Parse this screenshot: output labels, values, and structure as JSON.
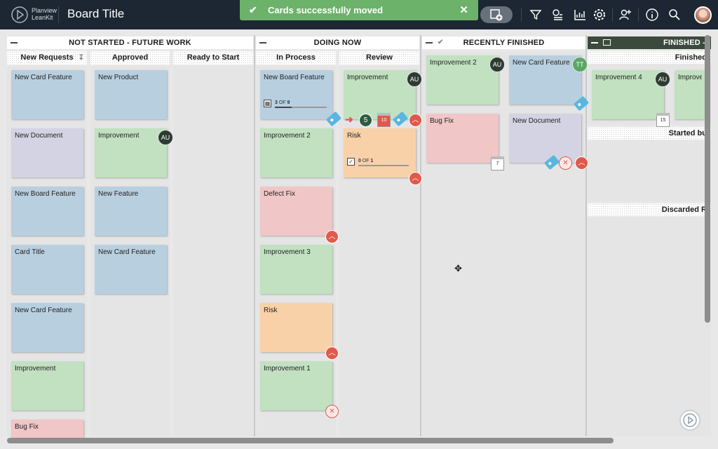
{
  "header": {
    "brand_line1": "Planview",
    "brand_line2": "LeanKit",
    "board_title": "Board Title",
    "toast_message": "Cards successfully moved",
    "colors": {
      "header_bg": "#1c2733",
      "toast_bg": "#6cb26a"
    },
    "icons": [
      "add-board-icon",
      "filter-icon",
      "filter-list-icon",
      "chart-icon",
      "gear-icon",
      "add-user-icon",
      "info-icon",
      "search-icon"
    ]
  },
  "lanes": {
    "not_started": "NOT STARTED - FUTURE WORK",
    "doing_now": "DOING NOW",
    "recently_finished": "RECENTLY FINISHED",
    "finished": "FINISHED -"
  },
  "columns": {
    "new_requests": "New Requests",
    "approved": "Approved",
    "ready_to_start": "Ready to Start",
    "in_process": "In Process",
    "review": "Review",
    "finished": "Finished",
    "started_bu": "Started bu",
    "discarded": "Discarded R"
  },
  "cards": {
    "new_requests": [
      "New Card Feature",
      "New Document",
      "New Board Feature",
      "Card Title",
      "New Card Feature",
      "Improvement",
      "Bug Fix"
    ],
    "approved": [
      "New Product",
      "Improvement",
      "New Feature",
      "New Card Feature"
    ],
    "in_process": [
      "New Board Feature",
      "Improvement 2",
      "Defect Fix",
      "Improvement 3",
      "Risk",
      "Improvement 1"
    ],
    "review": [
      "Improvement",
      "Risk"
    ],
    "recently_finished": [
      "Improvement 2",
      "New Card Feature",
      "Bug Fix",
      "New Document"
    ],
    "finished": [
      "Improvement 4",
      "Improve"
    ]
  },
  "badges": {
    "au": "AU",
    "tt": "TT"
  },
  "progress": {
    "in_process_1": {
      "done": "3",
      "of": "OF",
      "total": "9",
      "ratio": 0.33
    },
    "review_risk": {
      "done": "0",
      "of": "OF",
      "total": "1",
      "ratio": 0.0
    }
  },
  "misc": {
    "count_5": "5",
    "date_7": "7",
    "date_15": "15",
    "date_red": "10"
  }
}
